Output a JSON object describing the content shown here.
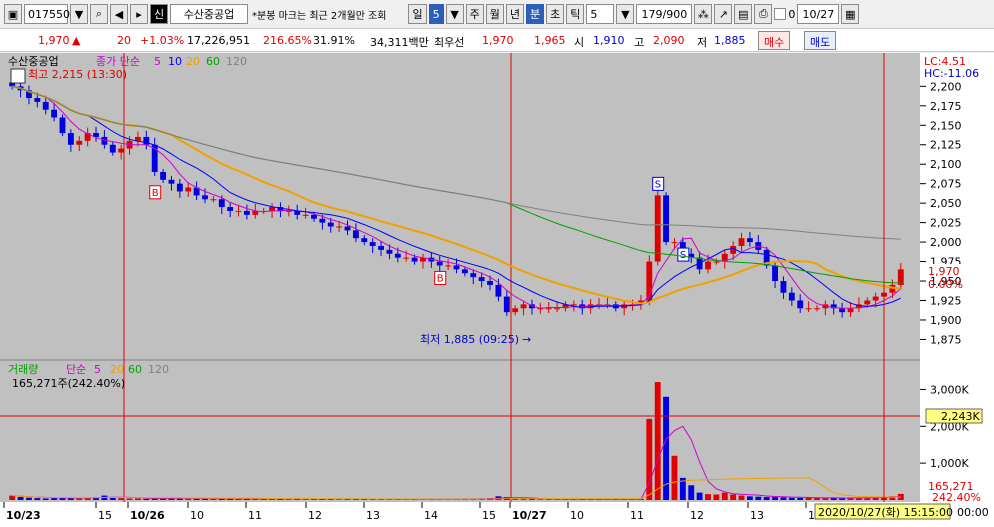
{
  "toolbar": {
    "code": "017550",
    "stock_name": "수산중공업",
    "notice": "*분봉 마크는 최근 2개월만 조회",
    "period_day": "일",
    "period_num": "5",
    "period_week": "주",
    "period_month": "월",
    "period_year": "년",
    "period_min": "분",
    "period_sec": "초",
    "period_tick": "틱",
    "interval": "5",
    "count": "179/900",
    "date": "10/27",
    "zero_label": "0"
  },
  "quote": {
    "price": "1,970",
    "change": "20",
    "change_pct": "+1.03%",
    "volume": "17,226,951",
    "vol_ratio": "216.65%",
    "turnover": "31.91%",
    "amount": "34,311백만",
    "best_ask_label": "최우선",
    "best_ask": "1,970",
    "best_bid": "1,965",
    "open_label": "시",
    "open": "1,910",
    "high_label": "고",
    "high": "2,090",
    "low_label": "저",
    "low": "1,885",
    "buy_label": "매수",
    "sell_label": "매도"
  },
  "price_legend": {
    "stock": "수산중공업",
    "ma_label": "종가 단순",
    "ma5": "5",
    "ma10": "10",
    "ma20": "20",
    "ma60": "60",
    "ma120": "120",
    "high_note": "최고 2,215 (13:30)",
    "low_note": "최저 1,885 (09:25)",
    "lc": "LC:4.51",
    "hc": "HC:-11.06",
    "cur_price_tag": "1,970",
    "cur_pct_tag": "0.00%"
  },
  "volume_legend": {
    "label": "거래량",
    "ma_label": "단순",
    "ma5": "5",
    "ma20": "20",
    "ma60": "60",
    "ma120": "120",
    "cur": "165,271주(242.40%)",
    "cursor_tag": "2,243K",
    "cur_vol_tag": "165,271",
    "cur_pct_tag": "242.40%"
  },
  "markers": {
    "buy": "B",
    "sell": "S"
  },
  "footer": {
    "cursor_time": "2020/10/27(화) 15:15:00",
    "tail": "00:00"
  },
  "colors": {
    "up": "#e00000",
    "down": "#0000e0",
    "ma5": "#d000d0",
    "ma10": "#0000ff",
    "ma20": "#f0a000",
    "ma60": "#00a000",
    "ma120": "#808080",
    "bg": "#c0c0c0"
  },
  "chart_data": {
    "type": "candlestick",
    "price_axis": {
      "ticks": [
        "2,200",
        "2,175",
        "2,150",
        "2,125",
        "2,100",
        "2,075",
        "2,050",
        "2,025",
        "2,000",
        "1,975",
        "1,950",
        "1,925",
        "1,900",
        "1,875"
      ],
      "range": [
        1855,
        2212
      ]
    },
    "volume_axis": {
      "ticks": [
        "3,000K",
        "2,000K",
        "1,000K"
      ],
      "range": [
        0,
        3500
      ]
    },
    "x_ticks": [
      "10/23",
      "15",
      "10/26",
      "10",
      "11",
      "12",
      "13",
      "14",
      "15",
      "10/27",
      "10",
      "11",
      "12",
      "13",
      "14"
    ],
    "day_separators": [
      "10/26",
      "10/27"
    ],
    "closes_approx": [
      2200,
      2195,
      2185,
      2180,
      2170,
      2160,
      2140,
      2125,
      2130,
      2140,
      2135,
      2125,
      2115,
      2120,
      2130,
      2135,
      2125,
      2090,
      2080,
      2075,
      2065,
      2070,
      2060,
      2055,
      2055,
      2045,
      2040,
      2040,
      2035,
      2040,
      2040,
      2045,
      2040,
      2040,
      2035,
      2035,
      2030,
      2025,
      2020,
      2020,
      2015,
      2005,
      2000,
      1995,
      1990,
      1985,
      1980,
      1980,
      1975,
      1980,
      1975,
      1970,
      1970,
      1965,
      1960,
      1955,
      1950,
      1945,
      1930,
      1910,
      1915,
      1920,
      1915,
      1915,
      1915,
      1915,
      1920,
      1920,
      1915,
      1920,
      1920,
      1920,
      1915,
      1920,
      1920,
      1925,
      1975,
      2060,
      2000,
      2000,
      1985,
      1980,
      1965,
      1975,
      1975,
      1985,
      1995,
      2005,
      2000,
      1990,
      1970,
      1950,
      1935,
      1925,
      1915,
      1915,
      1915,
      1920,
      1915,
      1910,
      1915,
      1920,
      1925,
      1930,
      1935,
      1945,
      1965
    ],
    "volumes_approx": [
      120,
      80,
      60,
      50,
      40,
      60,
      70,
      50,
      40,
      60,
      80,
      120,
      60,
      50,
      40,
      40,
      30,
      60,
      40,
      50,
      40,
      30,
      40,
      35,
      30,
      30,
      40,
      30,
      25,
      30,
      30,
      35,
      30,
      25,
      30,
      25,
      30,
      25,
      25,
      25,
      30,
      25,
      25,
      20,
      20,
      20,
      25,
      25,
      20,
      25,
      20,
      25,
      20,
      25,
      30,
      30,
      40,
      50,
      100,
      80,
      40,
      30,
      25,
      20,
      20,
      20,
      20,
      20,
      25,
      20,
      20,
      20,
      20,
      20,
      20,
      30,
      2200,
      3200,
      2800,
      1200,
      600,
      400,
      200,
      160,
      150,
      200,
      150,
      120,
      100,
      90,
      80,
      90,
      70,
      60,
      60,
      60,
      60,
      50,
      55,
      50,
      60,
      60,
      60,
      70,
      80,
      100,
      165
    ]
  }
}
